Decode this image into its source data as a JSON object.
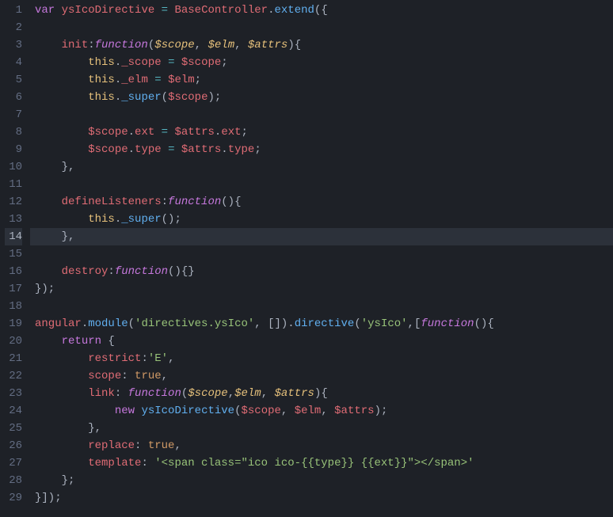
{
  "lineCount": 29,
  "activeLine": 14,
  "lines": [
    [
      [
        "tok-st",
        "var"
      ],
      [
        "tok-default",
        " "
      ],
      [
        "tok-var",
        "ysIcoDirective"
      ],
      [
        "tok-default",
        " "
      ],
      [
        "tok-op",
        "="
      ],
      [
        "tok-default",
        " "
      ],
      [
        "tok-var",
        "BaseController"
      ],
      [
        "tok-default",
        "."
      ],
      [
        "tok-call",
        "extend"
      ],
      [
        "tok-default",
        "({"
      ]
    ],
    [],
    [
      [
        "tok-default",
        "    "
      ],
      [
        "tok-prop",
        "init"
      ],
      [
        "tok-default",
        ":"
      ],
      [
        "tok-fnk",
        "function"
      ],
      [
        "tok-default",
        "("
      ],
      [
        "tok-param",
        "$scope"
      ],
      [
        "tok-default",
        ", "
      ],
      [
        "tok-param",
        "$elm"
      ],
      [
        "tok-default",
        ", "
      ],
      [
        "tok-param",
        "$attrs"
      ],
      [
        "tok-default",
        "){"
      ]
    ],
    [
      [
        "tok-default",
        "        "
      ],
      [
        "tok-this",
        "this"
      ],
      [
        "tok-default",
        "."
      ],
      [
        "tok-var",
        "_scope"
      ],
      [
        "tok-default",
        " "
      ],
      [
        "tok-op",
        "="
      ],
      [
        "tok-default",
        " "
      ],
      [
        "tok-var",
        "$scope"
      ],
      [
        "tok-default",
        ";"
      ]
    ],
    [
      [
        "tok-default",
        "        "
      ],
      [
        "tok-this",
        "this"
      ],
      [
        "tok-default",
        "."
      ],
      [
        "tok-var",
        "_elm"
      ],
      [
        "tok-default",
        " "
      ],
      [
        "tok-op",
        "="
      ],
      [
        "tok-default",
        " "
      ],
      [
        "tok-var",
        "$elm"
      ],
      [
        "tok-default",
        ";"
      ]
    ],
    [
      [
        "tok-default",
        "        "
      ],
      [
        "tok-this",
        "this"
      ],
      [
        "tok-default",
        "."
      ],
      [
        "tok-call",
        "_super"
      ],
      [
        "tok-default",
        "("
      ],
      [
        "tok-var",
        "$scope"
      ],
      [
        "tok-default",
        ");"
      ]
    ],
    [],
    [
      [
        "tok-default",
        "        "
      ],
      [
        "tok-var",
        "$scope"
      ],
      [
        "tok-default",
        "."
      ],
      [
        "tok-var",
        "ext"
      ],
      [
        "tok-default",
        " "
      ],
      [
        "tok-op",
        "="
      ],
      [
        "tok-default",
        " "
      ],
      [
        "tok-var",
        "$attrs"
      ],
      [
        "tok-default",
        "."
      ],
      [
        "tok-var",
        "ext"
      ],
      [
        "tok-default",
        ";"
      ]
    ],
    [
      [
        "tok-default",
        "        "
      ],
      [
        "tok-var",
        "$scope"
      ],
      [
        "tok-default",
        "."
      ],
      [
        "tok-var",
        "type"
      ],
      [
        "tok-default",
        " "
      ],
      [
        "tok-op",
        "="
      ],
      [
        "tok-default",
        " "
      ],
      [
        "tok-var",
        "$attrs"
      ],
      [
        "tok-default",
        "."
      ],
      [
        "tok-var",
        "type"
      ],
      [
        "tok-default",
        ";"
      ]
    ],
    [
      [
        "tok-default",
        "    },"
      ]
    ],
    [],
    [
      [
        "tok-default",
        "    "
      ],
      [
        "tok-prop",
        "defineListeners"
      ],
      [
        "tok-default",
        ":"
      ],
      [
        "tok-fnk",
        "function"
      ],
      [
        "tok-default",
        "(){"
      ]
    ],
    [
      [
        "tok-default",
        "        "
      ],
      [
        "tok-this",
        "this"
      ],
      [
        "tok-default",
        "."
      ],
      [
        "tok-call",
        "_super"
      ],
      [
        "tok-default",
        "();"
      ]
    ],
    [
      [
        "tok-default",
        "    },"
      ]
    ],
    [],
    [
      [
        "tok-default",
        "    "
      ],
      [
        "tok-prop",
        "destroy"
      ],
      [
        "tok-default",
        ":"
      ],
      [
        "tok-fnk",
        "function"
      ],
      [
        "tok-default",
        "(){}"
      ]
    ],
    [
      [
        "tok-default",
        "});"
      ]
    ],
    [],
    [
      [
        "tok-var",
        "angular"
      ],
      [
        "tok-default",
        "."
      ],
      [
        "tok-call",
        "module"
      ],
      [
        "tok-default",
        "("
      ],
      [
        "tok-str",
        "'directives.ysIco'"
      ],
      [
        "tok-default",
        ", [])."
      ],
      [
        "tok-call",
        "directive"
      ],
      [
        "tok-default",
        "("
      ],
      [
        "tok-str",
        "'ysIco'"
      ],
      [
        "tok-default",
        ",["
      ],
      [
        "tok-fnk",
        "function"
      ],
      [
        "tok-default",
        "(){"
      ]
    ],
    [
      [
        "tok-default",
        "    "
      ],
      [
        "tok-kw",
        "return"
      ],
      [
        "tok-default",
        " {"
      ]
    ],
    [
      [
        "tok-default",
        "        "
      ],
      [
        "tok-prop",
        "restrict"
      ],
      [
        "tok-default",
        ":"
      ],
      [
        "tok-str",
        "'E'"
      ],
      [
        "tok-default",
        ","
      ]
    ],
    [
      [
        "tok-default",
        "        "
      ],
      [
        "tok-prop",
        "scope"
      ],
      [
        "tok-default",
        ": "
      ],
      [
        "tok-lit",
        "true"
      ],
      [
        "tok-default",
        ","
      ]
    ],
    [
      [
        "tok-default",
        "        "
      ],
      [
        "tok-prop",
        "link"
      ],
      [
        "tok-default",
        ": "
      ],
      [
        "tok-fnk",
        "function"
      ],
      [
        "tok-default",
        "("
      ],
      [
        "tok-param",
        "$scope"
      ],
      [
        "tok-default",
        ","
      ],
      [
        "tok-param",
        "$elm"
      ],
      [
        "tok-default",
        ", "
      ],
      [
        "tok-param",
        "$attrs"
      ],
      [
        "tok-default",
        "){"
      ]
    ],
    [
      [
        "tok-default",
        "            "
      ],
      [
        "tok-st",
        "new"
      ],
      [
        "tok-default",
        " "
      ],
      [
        "tok-call",
        "ysIcoDirective"
      ],
      [
        "tok-default",
        "("
      ],
      [
        "tok-var",
        "$scope"
      ],
      [
        "tok-default",
        ", "
      ],
      [
        "tok-var",
        "$elm"
      ],
      [
        "tok-default",
        ", "
      ],
      [
        "tok-var",
        "$attrs"
      ],
      [
        "tok-default",
        ");"
      ]
    ],
    [
      [
        "tok-default",
        "        },"
      ]
    ],
    [
      [
        "tok-default",
        "        "
      ],
      [
        "tok-prop",
        "replace"
      ],
      [
        "tok-default",
        ": "
      ],
      [
        "tok-lit",
        "true"
      ],
      [
        "tok-default",
        ","
      ]
    ],
    [
      [
        "tok-default",
        "        "
      ],
      [
        "tok-prop",
        "template"
      ],
      [
        "tok-default",
        ": "
      ],
      [
        "tok-str",
        "'<span class=\"ico ico-{{type}} {{ext}}\"></span>'"
      ]
    ],
    [
      [
        "tok-default",
        "    };"
      ]
    ],
    [
      [
        "tok-default",
        "}]);"
      ]
    ]
  ]
}
